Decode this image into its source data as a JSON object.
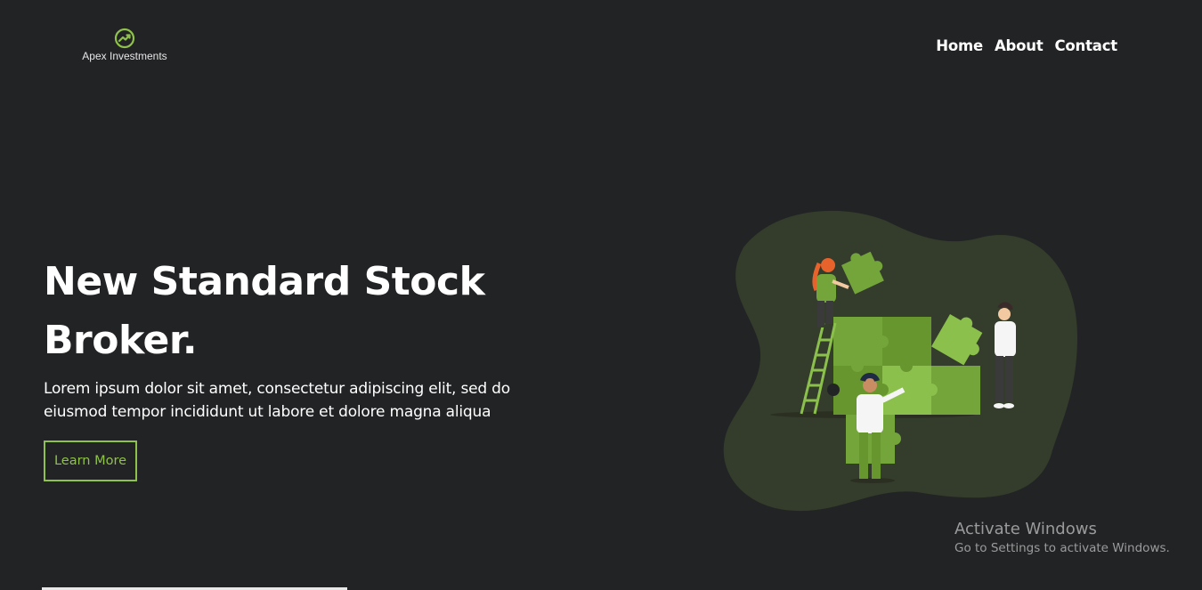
{
  "brand": {
    "name": "Apex Investments",
    "icon": "trending-up-icon",
    "accent": "#8fc24a"
  },
  "nav": {
    "items": [
      "Home",
      "About",
      "Contact"
    ]
  },
  "hero": {
    "title": "New Standard Stock Broker.",
    "subtitle": "Lorem ipsum dolor sit amet, consectetur adipiscing elit, sed do eiusmod tempor incididunt ut labore et dolore magna aliqua",
    "cta_label": "Learn More"
  },
  "illustration": {
    "name": "puzzle-team-illustration",
    "blob_color": "#343c2b"
  },
  "watermark": {
    "title": "Activate Windows",
    "subtitle": "Go to Settings to activate Windows."
  },
  "theme": {
    "background": "#222325",
    "text": "#ffffff"
  }
}
